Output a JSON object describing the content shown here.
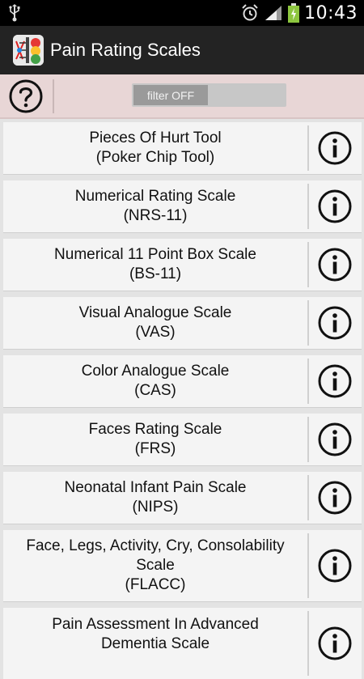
{
  "status_bar": {
    "time": "10:43",
    "icons": [
      "usb-icon",
      "alarm-icon",
      "signal-icon",
      "battery-charging-icon"
    ]
  },
  "action_bar": {
    "title": "Pain Rating Scales",
    "icon": "app-icon"
  },
  "filter_bar": {
    "help_icon": "question-icon",
    "toggle_label": "filter OFF"
  },
  "scales": [
    {
      "name": "Pieces Of Hurt Tool",
      "abbr": "(Poker Chip Tool)"
    },
    {
      "name": "Numerical Rating Scale",
      "abbr": "(NRS-11)"
    },
    {
      "name": "Numerical 11 Point Box Scale",
      "abbr": "(BS-11)"
    },
    {
      "name": "Visual Analogue Scale",
      "abbr": "(VAS)"
    },
    {
      "name": "Color Analogue Scale",
      "abbr": "(CAS)"
    },
    {
      "name": "Faces Rating Scale",
      "abbr": "(FRS)"
    },
    {
      "name": "Neonatal Infant Pain Scale",
      "abbr": "(NIPS)"
    },
    {
      "name": "Face, Legs, Activity, Cry, Consolability",
      "name2": "Scale",
      "abbr": "(FLACC)"
    },
    {
      "name": "Pain Assessment In Advanced",
      "name2": "Dementia Scale",
      "abbr": ""
    }
  ],
  "info_icon": "info-icon"
}
